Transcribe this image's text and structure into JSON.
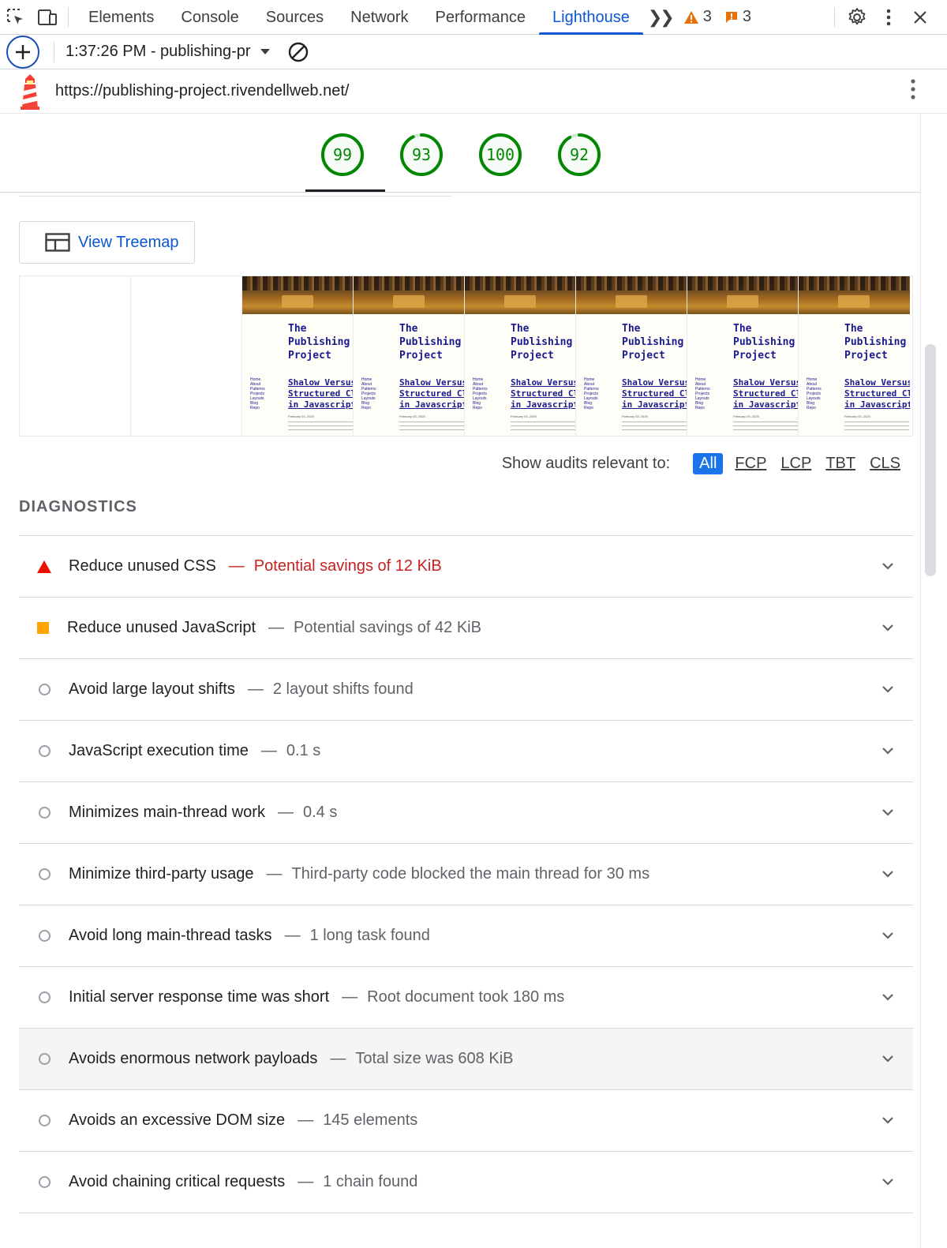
{
  "devtools": {
    "tabs": [
      "Elements",
      "Console",
      "Sources",
      "Network",
      "Performance",
      "Lighthouse"
    ],
    "active_tab": "Lighthouse",
    "warnings_count": "3",
    "issues_count": "3"
  },
  "report_toolbar": {
    "selected_report": "1:37:26 PM - publishing-pr"
  },
  "urlbar": {
    "url": "https://publishing-project.rivendellweb.net/"
  },
  "gauges": [
    {
      "score": "99",
      "value": 0.99
    },
    {
      "score": "93",
      "value": 0.93
    },
    {
      "score": "100",
      "value": 1.0
    },
    {
      "score": "92",
      "value": 0.92
    }
  ],
  "treemap_button": "View Treemap",
  "filmstrip": {
    "site_title_lines": [
      "The",
      "Publishing",
      "Project"
    ],
    "post_title_lines": [
      "Shalow Versus",
      "Structured Clon",
      "in Javascript"
    ],
    "nav_lines": [
      "Home",
      "About",
      "Patterns",
      "Projects",
      "Layouts",
      "Blog",
      "Repo"
    ],
    "date": "February 03, 2025",
    "blank_frames": 2,
    "rendered_frames": 6
  },
  "filters": {
    "label": "Show audits relevant to:",
    "options": [
      "All",
      "FCP",
      "LCP",
      "TBT",
      "CLS"
    ],
    "active": "All"
  },
  "diagnostics": {
    "heading": "DIAGNOSTICS",
    "audits": [
      {
        "status": "fail",
        "title": "Reduce unused CSS",
        "display": "Potential savings of 12 KiB"
      },
      {
        "status": "average",
        "title": "Reduce unused JavaScript",
        "display": "Potential savings of 42 KiB"
      },
      {
        "status": "info",
        "title": "Avoid large layout shifts",
        "display": "2 layout shifts found"
      },
      {
        "status": "info",
        "title": "JavaScript execution time",
        "display": "0.1 s"
      },
      {
        "status": "info",
        "title": "Minimizes main-thread work",
        "display": "0.4 s"
      },
      {
        "status": "info",
        "title": "Minimize third-party usage",
        "display": "Third-party code blocked the main thread for 30 ms"
      },
      {
        "status": "info",
        "title": "Avoid long main-thread tasks",
        "display": "1 long task found"
      },
      {
        "status": "info",
        "title": "Initial server response time was short",
        "display": "Root document took 180 ms"
      },
      {
        "status": "info",
        "title": "Avoids enormous network payloads",
        "display": "Total size was 608 KiB"
      },
      {
        "status": "info",
        "title": "Avoids an excessive DOM size",
        "display": "145 elements"
      },
      {
        "status": "info",
        "title": "Avoid chaining critical requests",
        "display": "1 chain found"
      }
    ]
  },
  "colors": {
    "accent": "#0b57d0",
    "pass": "#008800",
    "fail": "#eb0f00",
    "average": "#ffa400"
  }
}
